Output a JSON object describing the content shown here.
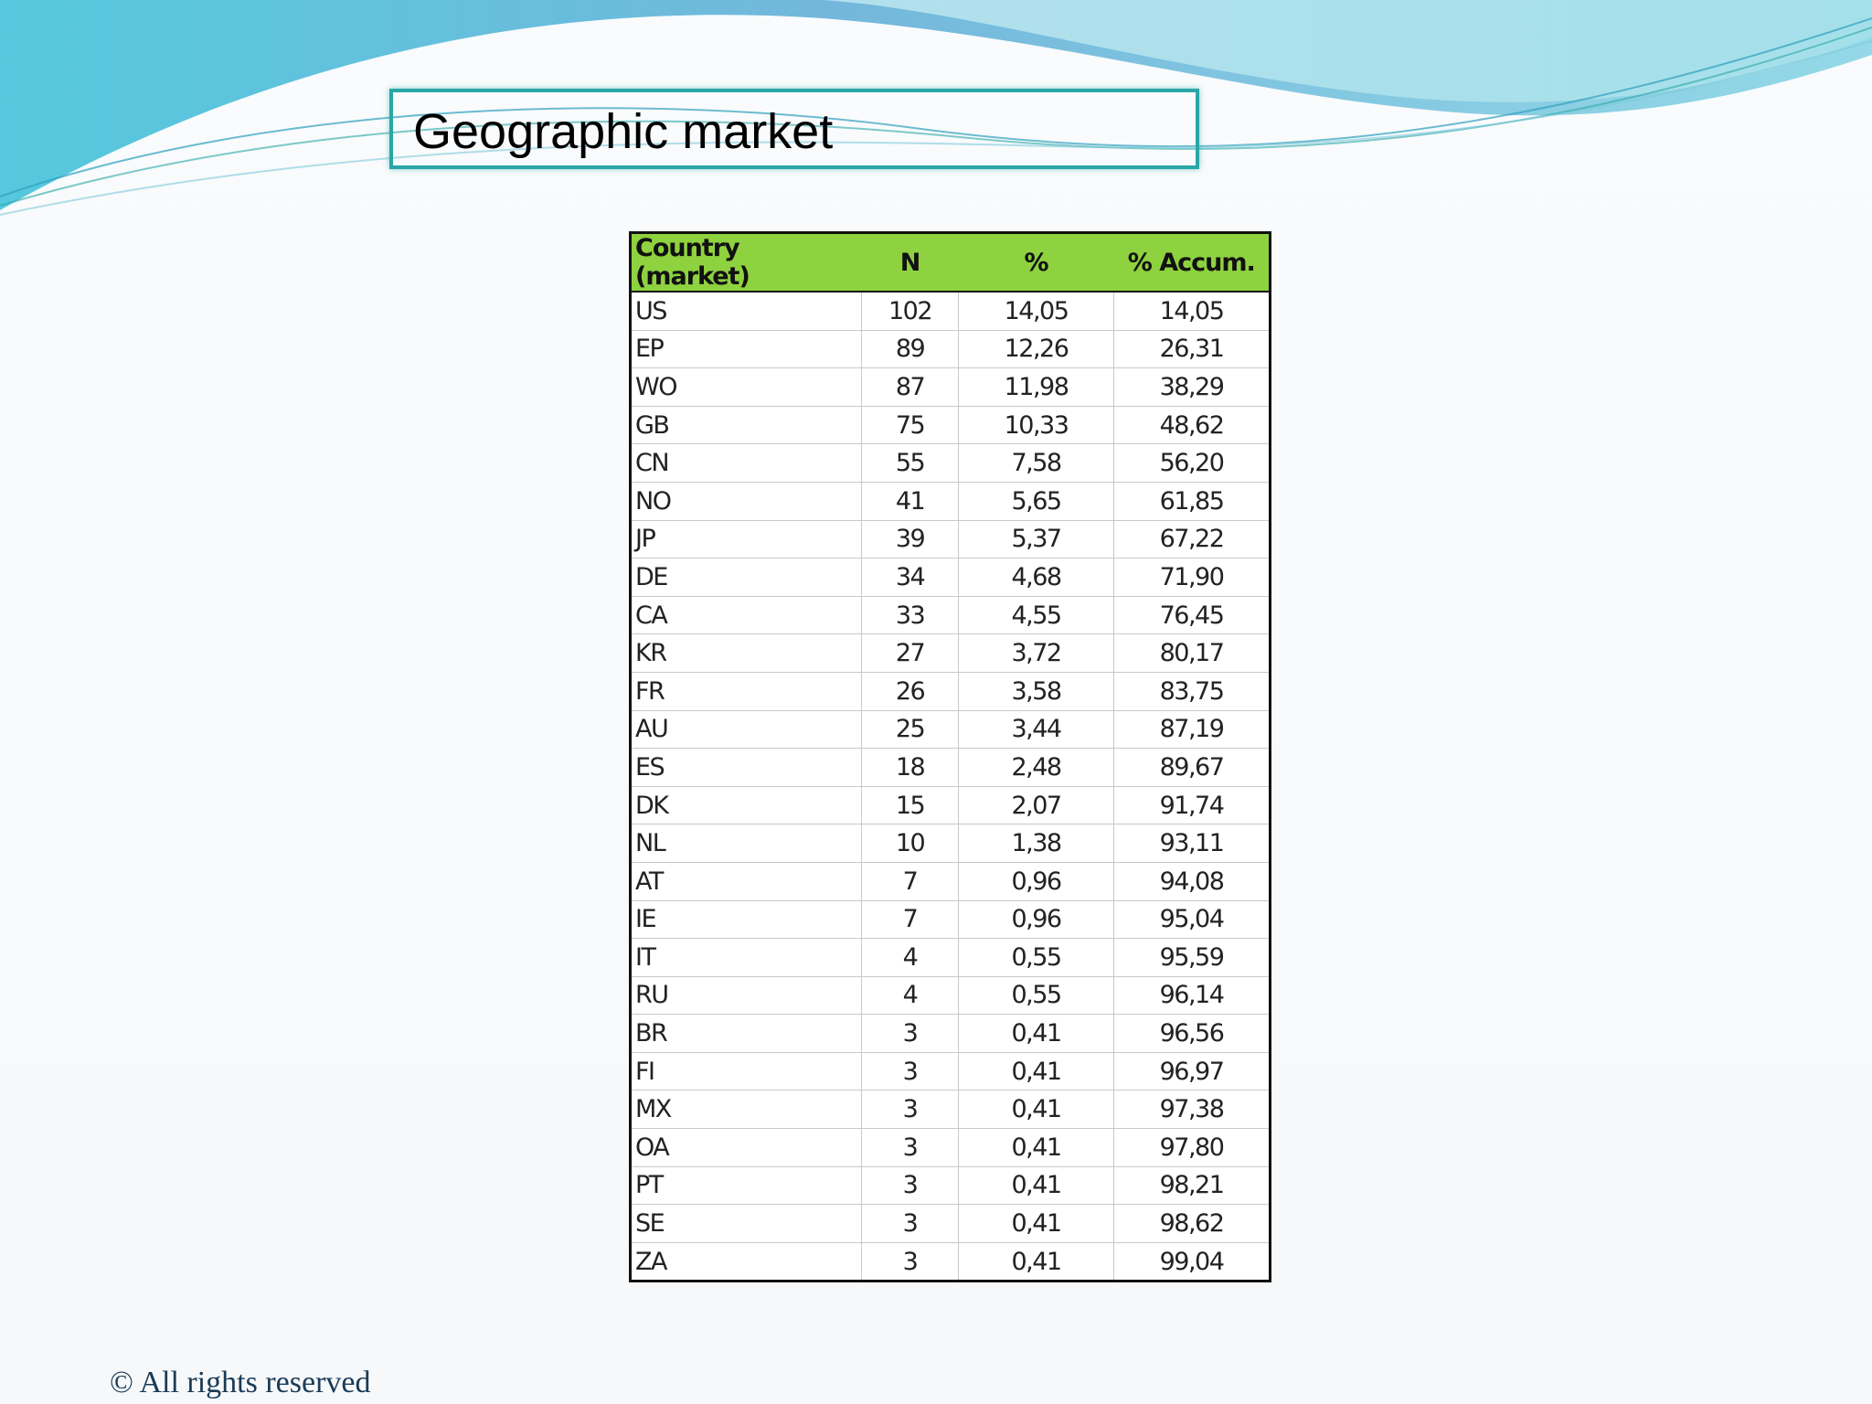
{
  "slide": {
    "title": "Geographic market",
    "footer": "© All rights reserved"
  },
  "colors": {
    "title_border": "#2aa6a6",
    "header_fill": "#8ed23f",
    "wave_dark": "#5bb8dc",
    "wave_light": "#9ed9e8"
  },
  "table": {
    "headers": [
      "Country (market)",
      "N",
      "%",
      "% Accum."
    ],
    "rows": [
      [
        "US",
        "102",
        "14,05",
        "14,05"
      ],
      [
        "EP",
        "89",
        "12,26",
        "26,31"
      ],
      [
        "WO",
        "87",
        "11,98",
        "38,29"
      ],
      [
        "GB",
        "75",
        "10,33",
        "48,62"
      ],
      [
        "CN",
        "55",
        "7,58",
        "56,20"
      ],
      [
        "NO",
        "41",
        "5,65",
        "61,85"
      ],
      [
        "JP",
        "39",
        "5,37",
        "67,22"
      ],
      [
        "DE",
        "34",
        "4,68",
        "71,90"
      ],
      [
        "CA",
        "33",
        "4,55",
        "76,45"
      ],
      [
        "KR",
        "27",
        "3,72",
        "80,17"
      ],
      [
        "FR",
        "26",
        "3,58",
        "83,75"
      ],
      [
        "AU",
        "25",
        "3,44",
        "87,19"
      ],
      [
        "ES",
        "18",
        "2,48",
        "89,67"
      ],
      [
        "DK",
        "15",
        "2,07",
        "91,74"
      ],
      [
        "NL",
        "10",
        "1,38",
        "93,11"
      ],
      [
        "AT",
        "7",
        "0,96",
        "94,08"
      ],
      [
        "IE",
        "7",
        "0,96",
        "95,04"
      ],
      [
        "IT",
        "4",
        "0,55",
        "95,59"
      ],
      [
        "RU",
        "4",
        "0,55",
        "96,14"
      ],
      [
        "BR",
        "3",
        "0,41",
        "96,56"
      ],
      [
        "FI",
        "3",
        "0,41",
        "96,97"
      ],
      [
        "MX",
        "3",
        "0,41",
        "97,38"
      ],
      [
        "OA",
        "3",
        "0,41",
        "97,80"
      ],
      [
        "PT",
        "3",
        "0,41",
        "98,21"
      ],
      [
        "SE",
        "3",
        "0,41",
        "98,62"
      ],
      [
        "ZA",
        "3",
        "0,41",
        "99,04"
      ]
    ]
  }
}
